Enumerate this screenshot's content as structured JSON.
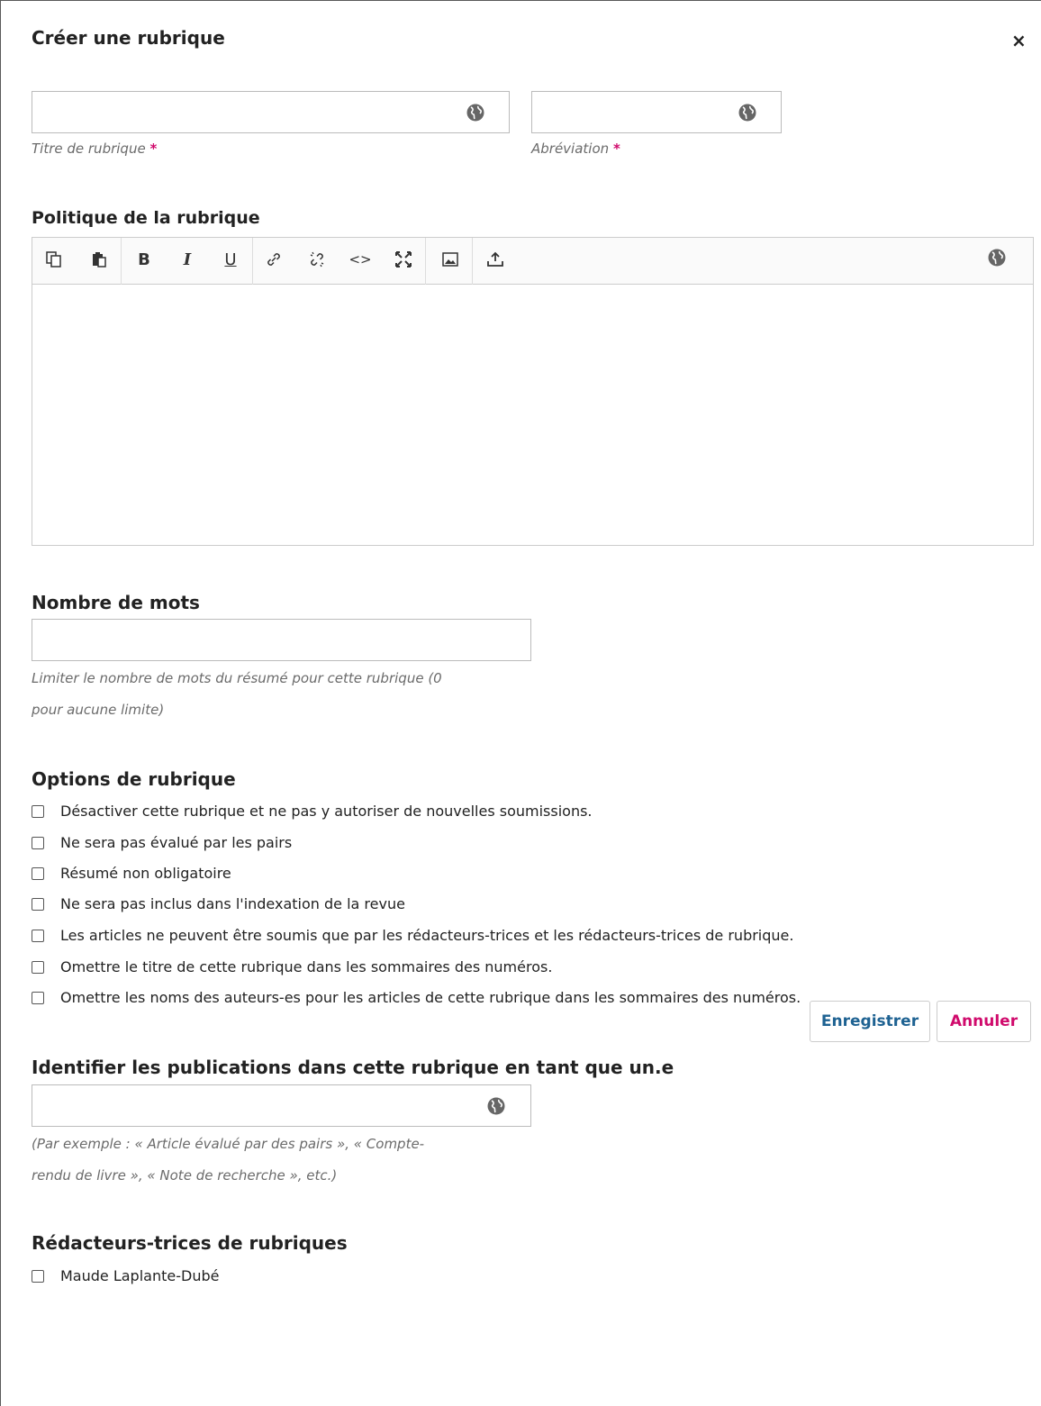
{
  "modal": {
    "title": "Créer une rubrique",
    "close_label": "×"
  },
  "section_title_field": {
    "value": "",
    "label": "Titre de rubrique",
    "required_mark": "*"
  },
  "abbreviation_field": {
    "value": "",
    "label": "Abréviation",
    "required_mark": "*"
  },
  "policy": {
    "title": "Politique de la rubrique",
    "content": "",
    "toolbar": [
      "copy-icon",
      "paste-icon",
      "bold-icon",
      "italic-icon",
      "underline-icon",
      "link-icon",
      "unlink-icon",
      "code-icon",
      "fullscreen-icon",
      "image-icon",
      "upload-icon",
      "globe-icon"
    ],
    "bold_glyph": "B",
    "italic_glyph": "I",
    "underline_glyph": "U",
    "code_glyph": "<>"
  },
  "word_count": {
    "title": "Nombre de mots",
    "value": "",
    "help_line1": "Limiter le nombre de mots du résumé pour cette rubrique (0",
    "help_line2": "pour aucune limite)"
  },
  "options": {
    "title": "Options de rubrique",
    "items": [
      "Désactiver cette rubrique et ne pas y autoriser de nouvelles soumissions.",
      "Ne sera pas évalué par les pairs",
      "Résumé non obligatoire",
      "Ne sera pas inclus dans l'indexation de la revue",
      "Les articles ne peuvent être soumis que par les rédacteurs-trices et les rédacteurs-trices de rubrique.",
      "Omettre le titre de cette rubrique dans les sommaires des numéros.",
      "Omettre les noms des auteurs-es pour les articles de cette rubrique dans les sommaires des numéros."
    ]
  },
  "identify": {
    "title": "Identifier les publications dans cette rubrique en tant que un.e",
    "value": "",
    "help_line1": "(Par exemple : « Article évalué par des pairs », « Compte-",
    "help_line2": "rendu de livre », « Note de recherche », etc.)"
  },
  "editors": {
    "title": "Rédacteurs-trices de rubriques",
    "items": [
      "Maude Laplante-Dubé"
    ]
  },
  "actions": {
    "save_label": "Enregistrer",
    "cancel_label": "Annuler"
  },
  "colors": {
    "required": "#d00a6c",
    "save_text": "#1e6292",
    "cancel_text": "#d00a6c",
    "globe": "#666666"
  }
}
